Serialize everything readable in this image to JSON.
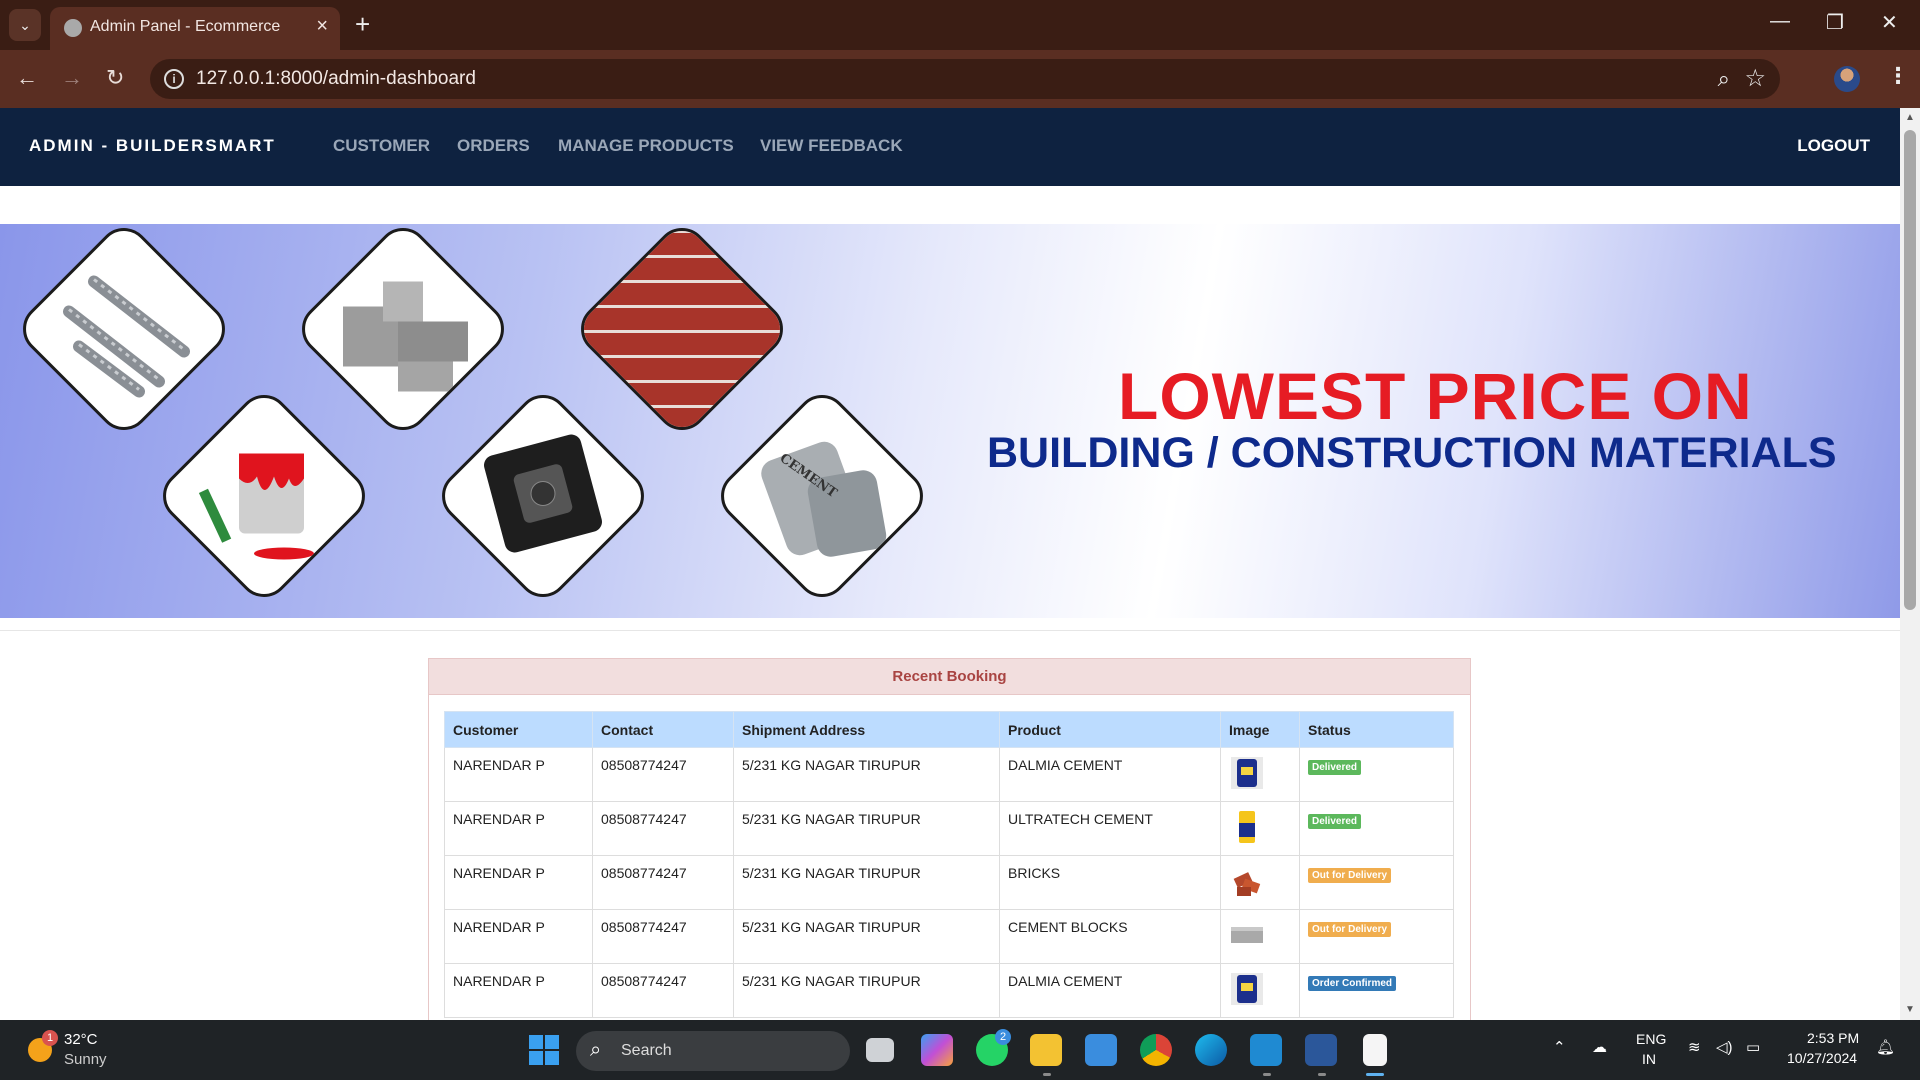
{
  "browser": {
    "tab_title": "Admin Panel - Ecommerce",
    "url": "127.0.0.1:8000/admin-dashboard"
  },
  "navbar": {
    "brand": "ADMIN - BUILDERSMART",
    "links": [
      "CUSTOMER",
      "ORDERS",
      "MANAGE PRODUCTS",
      "VIEW FEEDBACK"
    ],
    "logout": "LOGOUT"
  },
  "banner": {
    "headline": "LOWEST PRICE ON",
    "subheadline": "BUILDING / CONSTRUCTION MATERIALS",
    "tiles": [
      "steel-rods",
      "concrete-blocks",
      "brick-wall",
      "paint-bucket",
      "electric-switch",
      "cement-bags"
    ],
    "bag_label": "CEMENT"
  },
  "booking": {
    "title": "Recent Booking",
    "columns": [
      "Customer",
      "Contact",
      "Shipment Address",
      "Product",
      "Image",
      "Status"
    ],
    "rows": [
      {
        "customer": "NARENDAR P",
        "contact": "08508774247",
        "address": "5/231 KG NAGAR TIRUPUR",
        "product": "DALMIA CEMENT",
        "image": "cement-bag-blue",
        "status": "Delivered"
      },
      {
        "customer": "NARENDAR P",
        "contact": "08508774247",
        "address": "5/231 KG NAGAR TIRUPUR",
        "product": "ULTRATECH CEMENT",
        "image": "cement-bag-yellow",
        "status": "Delivered"
      },
      {
        "customer": "NARENDAR P",
        "contact": "08508774247",
        "address": "5/231 KG NAGAR TIRUPUR",
        "product": "BRICKS",
        "image": "bricks",
        "status": "Out for Delivery"
      },
      {
        "customer": "NARENDAR P",
        "contact": "08508774247",
        "address": "5/231 KG NAGAR TIRUPUR",
        "product": "CEMENT BLOCKS",
        "image": "cement-block",
        "status": "Out for Delivery"
      },
      {
        "customer": "NARENDAR P",
        "contact": "08508774247",
        "address": "5/231 KG NAGAR TIRUPUR",
        "product": "DALMIA CEMENT",
        "image": "cement-bag-blue",
        "status": "Order Confirmed"
      }
    ],
    "status_colors": {
      "Delivered": "#5cb85c",
      "Out for Delivery": "#f0ad4e",
      "Order Confirmed": "#337ab7"
    }
  },
  "taskbar": {
    "weather_temp": "32°C",
    "weather_desc": "Sunny",
    "weather_badge": "1",
    "search_label": "Search",
    "whatsapp_badge": "2",
    "lang_line1": "ENG",
    "lang_line2": "IN",
    "time": "2:53 PM",
    "date": "10/27/2024"
  },
  "colors": {
    "navbar": "#0e2240",
    "headline": "#e61c24",
    "subheadline": "#0e2a8c"
  }
}
